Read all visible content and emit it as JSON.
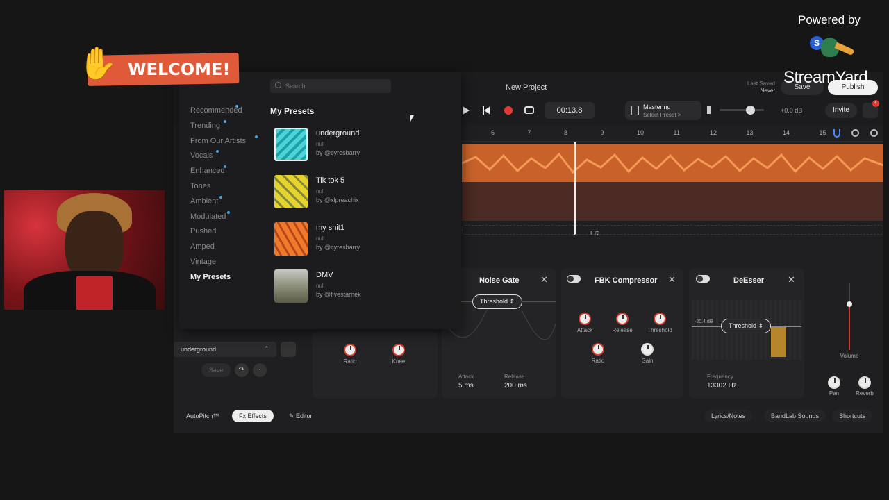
{
  "overlay": {
    "welcome": "WELCOME!",
    "powered_by": "Powered by",
    "brand": "StreamYard"
  },
  "header": {
    "project_title": "New Project",
    "last_saved_label": "Last Saved",
    "last_saved_value": "Never",
    "save": "Save",
    "publish": "Publish",
    "invite": "Invite",
    "notification_count": "4"
  },
  "transport": {
    "time": "00:13.8",
    "mastering_label": "Mastering",
    "mastering_sub": "Select Preset >",
    "volume_db": "+0.0 dB"
  },
  "ruler": [
    "6",
    "7",
    "8",
    "9",
    "10",
    "11",
    "12",
    "13",
    "14",
    "15"
  ],
  "dropdown": {
    "search_placeholder": "Search",
    "section_title": "My Presets",
    "categories": [
      {
        "label": "Recommended",
        "dot": true
      },
      {
        "label": "Trending",
        "dot": true
      },
      {
        "label": "From Our Artists",
        "dot": true
      },
      {
        "label": "Vocals",
        "dot": true
      },
      {
        "label": "Enhanced",
        "dot": true
      },
      {
        "label": "Tones",
        "dot": false
      },
      {
        "label": "Ambient",
        "dot": true
      },
      {
        "label": "Modulated",
        "dot": true
      },
      {
        "label": "Pushed",
        "dot": false
      },
      {
        "label": "Amped",
        "dot": false
      },
      {
        "label": "Vintage",
        "dot": false
      },
      {
        "label": "My Presets",
        "dot": false
      }
    ],
    "presets": [
      {
        "name": "underground",
        "sub": "null",
        "by": "by @cyresbarry"
      },
      {
        "name": "Tik tok 5",
        "sub": "null",
        "by": "by @xlpreachix"
      },
      {
        "name": "my shit1",
        "sub": "null",
        "by": "by @cyresbarry"
      },
      {
        "name": "DMV",
        "sub": "null",
        "by": "by @fivestarnek"
      }
    ]
  },
  "track_controls": {
    "preset_select": "underground",
    "save": "Save"
  },
  "effects": {
    "left_knobs": [
      "Ratio",
      "Knee"
    ],
    "noise_gate": {
      "title": "Noise Gate",
      "threshold": "Threshold",
      "attack_label": "Attack",
      "attack_value": "5 ms",
      "release_label": "Release",
      "release_value": "200 ms"
    },
    "compressor": {
      "title": "FBK Compressor",
      "knobs": [
        "Attack",
        "Release",
        "Threshold",
        "Ratio",
        "Gain"
      ]
    },
    "deesser": {
      "title": "DeEsser",
      "threshold": "Threshold",
      "db_label": "-20.4 dB",
      "freq_label": "Frequency",
      "freq_value": "13302 Hz"
    },
    "volume": "Volume",
    "pan": "Pan",
    "reverb": "Reverb"
  },
  "bottombar": {
    "autopitch": "AutoPitch™",
    "effects": "Effects",
    "editor": "Editor",
    "lyrics": "Lyrics/Notes",
    "bandlab_sounds": "BandLab Sounds",
    "shortcuts": "Shortcuts"
  }
}
